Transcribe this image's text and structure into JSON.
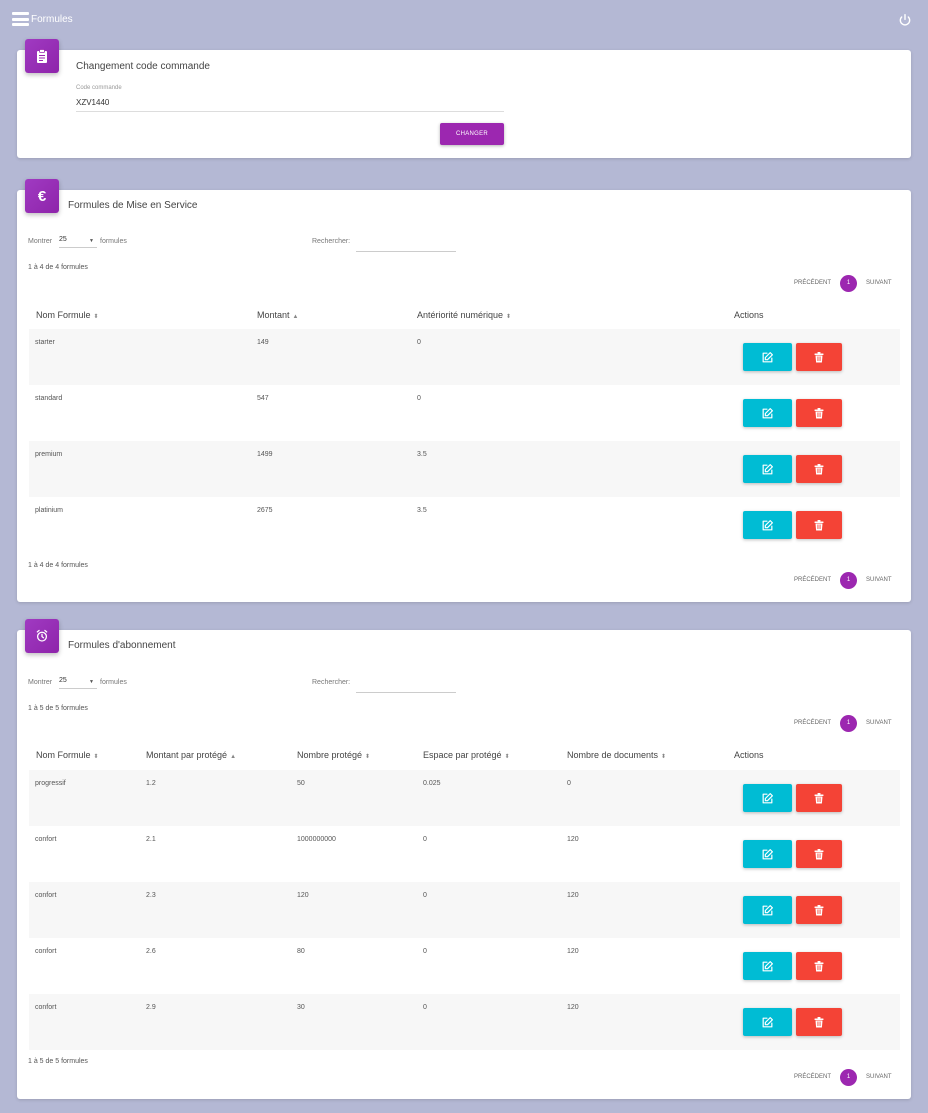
{
  "header": {
    "title": "Formules",
    "menu_icon": "hamburger-menu-icon",
    "power_icon": "power-icon"
  },
  "code_card": {
    "icon": "clipboard-icon",
    "title": "Changement code commande",
    "field_label": "Code commande",
    "field_value": "XZV1440",
    "button_label": "CHANGER"
  },
  "mes_card": {
    "icon": "euro-icon",
    "title": "Formules de Mise en Service",
    "show_label": "Montrer",
    "show_value": "25",
    "show_suffix": "formules",
    "search_label": "Rechercher:",
    "info": "1 à 4 de 4 formules",
    "pager": {
      "prev": "PRÉCÉDENT",
      "page": "1",
      "next": "SUIVANT"
    },
    "columns": [
      "Nom Formule",
      "Montant",
      "Antériorité numérique",
      "Actions"
    ],
    "rows": [
      [
        "starter",
        "149",
        "0"
      ],
      [
        "standard",
        "547",
        "0"
      ],
      [
        "premium",
        "1499",
        "3.5"
      ],
      [
        "platinium",
        "2675",
        "3.5"
      ]
    ]
  },
  "abo_card": {
    "icon": "alarm-clock-icon",
    "title": "Formules d'abonnement",
    "show_label": "Montrer",
    "show_value": "25",
    "show_suffix": "formules",
    "search_label": "Rechercher:",
    "info": "1 à 5 de 5 formules",
    "pager": {
      "prev": "PRÉCÉDENT",
      "page": "1",
      "next": "SUIVANT"
    },
    "columns": [
      "Nom Formule",
      "Montant par protégé",
      "Nombre protégé",
      "Espace par protégé",
      "Nombre de documents",
      "Actions"
    ],
    "rows": [
      [
        "progressif",
        "1.2",
        "50",
        "0.025",
        "0"
      ],
      [
        "confort",
        "2.1",
        "1000000000",
        "0",
        "120"
      ],
      [
        "confort",
        "2.3",
        "120",
        "0",
        "120"
      ],
      [
        "confort",
        "2.6",
        "80",
        "0",
        "120"
      ],
      [
        "confort",
        "2.9",
        "30",
        "0",
        "120"
      ]
    ]
  },
  "colors": {
    "primary": "#9c27b0",
    "edit": "#00bcd4",
    "delete": "#f44336",
    "background": "#b4b8d4"
  }
}
